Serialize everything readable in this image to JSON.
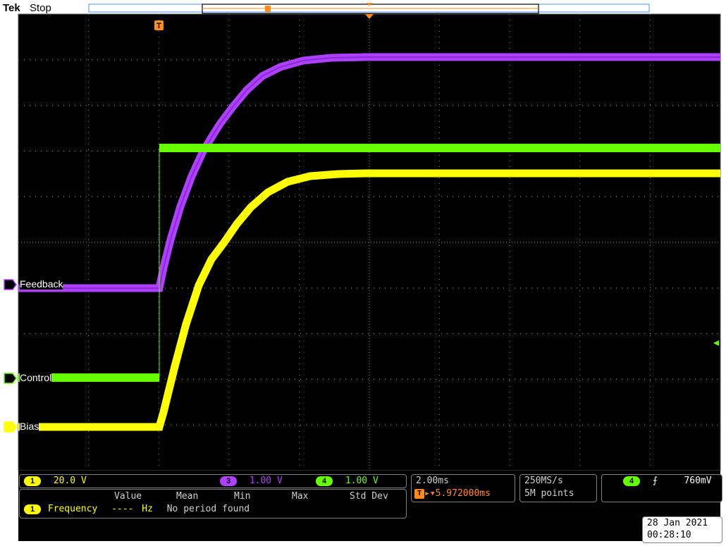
{
  "header": {
    "brand": "Tek",
    "run_state": "Stop",
    "trigger_marker": "T"
  },
  "channels": [
    {
      "id": "3",
      "label": "Feedback",
      "color": "#b040ff",
      "scale": "1.00 V"
    },
    {
      "id": "4",
      "label": "Control",
      "color": "#66ff00",
      "scale": "1.00 V"
    },
    {
      "id": "1",
      "label": "Bias",
      "color": "#ffff00",
      "scale": "20.0 V"
    }
  ],
  "measurements": {
    "headers": [
      "Value",
      "Mean",
      "Min",
      "Max",
      "Std Dev"
    ],
    "row": {
      "channel": "1",
      "name": "Frequency",
      "value": "----",
      "unit": "Hz",
      "note": "No period found"
    }
  },
  "horizontal": {
    "time_per_div": "2.00ms",
    "position": "5.972000ms"
  },
  "acquisition": {
    "sample_rate": "250MS/s",
    "record_length": "5M points"
  },
  "trigger": {
    "channel": "4",
    "slope": "rising",
    "level": "760mV"
  },
  "datetime": {
    "date": "28 Jan  2021",
    "time": "00:28:10"
  },
  "colors": {
    "trigger": "#ff8c1a",
    "grid": "#8a8a8a",
    "background": "#000000"
  }
}
